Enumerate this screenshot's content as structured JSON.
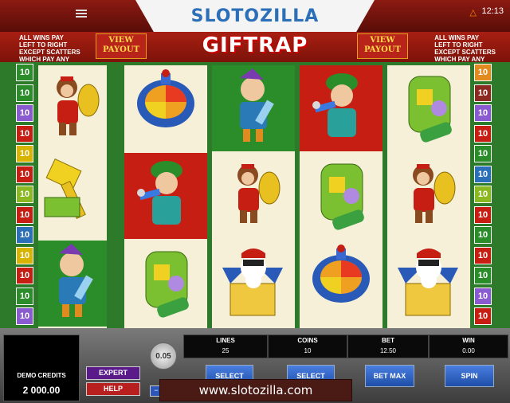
{
  "header": {
    "logo": "SLOTOZILLA",
    "clock": "12:13",
    "flame_icon": "flame-icon"
  },
  "banner": {
    "title": "GIFTRAP",
    "rules_left": [
      "ALL WINS PAY",
      "LEFT TO RIGHT",
      "EXCEPT SCATTERS",
      "WHICH PAY ANY"
    ],
    "rules_right": [
      "ALL WINS PAY",
      "LEFT TO RIGHT",
      "EXCEPT SCATTERS",
      "WHICH PAY ANY"
    ],
    "view_payout_left": "VIEW\nPAYOUT",
    "view_payout_right": "VIEW\nPAYOUT"
  },
  "paylines_left": [
    {
      "label": "10",
      "color": "#2a8d2a"
    },
    {
      "label": "10",
      "color": "#2a8d2a"
    },
    {
      "label": "10",
      "color": "#8a5ad0"
    },
    {
      "label": "10",
      "color": "#c71e14"
    },
    {
      "label": "10",
      "color": "#d8b400"
    },
    {
      "label": "10",
      "color": "#c71e14"
    },
    {
      "label": "10",
      "color": "#8ab820"
    },
    {
      "label": "10",
      "color": "#c71e14"
    },
    {
      "label": "10",
      "color": "#2a6fb8"
    },
    {
      "label": "10",
      "color": "#d8b400"
    },
    {
      "label": "10",
      "color": "#c71e14"
    },
    {
      "label": "10",
      "color": "#2a8d2a"
    },
    {
      "label": "10",
      "color": "#8a5ad0"
    }
  ],
  "paylines_right": [
    {
      "label": "10",
      "color": "#e08a20"
    },
    {
      "label": "10",
      "color": "#8a2a20"
    },
    {
      "label": "10",
      "color": "#8a5ad0"
    },
    {
      "label": "10",
      "color": "#c71e14"
    },
    {
      "label": "10",
      "color": "#2a8d2a"
    },
    {
      "label": "10",
      "color": "#2a6fb8"
    },
    {
      "label": "10",
      "color": "#8ab820"
    },
    {
      "label": "10",
      "color": "#c71e14"
    },
    {
      "label": "10",
      "color": "#2a8d2a"
    },
    {
      "label": "10",
      "color": "#c71e14"
    },
    {
      "label": "10",
      "color": "#2a8d2a"
    },
    {
      "label": "10",
      "color": "#8a5ad0"
    },
    {
      "label": "10",
      "color": "#c71e14"
    }
  ],
  "reels": [
    [
      {
        "symbol": "monkey-cymbals-icon",
        "bg": "plain"
      },
      {
        "symbol": "toy-hammer-icon",
        "bg": "plain"
      },
      {
        "symbol": "elf-icon",
        "bg": "green"
      }
    ],
    [
      {
        "symbol": "spinning-top-icon",
        "bg": "plain"
      },
      {
        "symbol": "singer-elf-icon",
        "bg": "red"
      },
      {
        "symbol": "toy-phone-icon",
        "bg": "plain"
      }
    ],
    [
      {
        "symbol": "elf-icon",
        "bg": "green"
      },
      {
        "symbol": "monkey-cymbals-icon",
        "bg": "plain"
      },
      {
        "symbol": "jack-in-box-icon",
        "bg": "plain"
      }
    ],
    [
      {
        "symbol": "singer-elf-icon",
        "bg": "red"
      },
      {
        "symbol": "toy-phone-icon",
        "bg": "plain"
      },
      {
        "symbol": "spinning-top-icon",
        "bg": "plain"
      }
    ],
    [
      {
        "symbol": "toy-phone-icon",
        "bg": "plain"
      },
      {
        "symbol": "monkey-cymbals-icon",
        "bg": "plain"
      },
      {
        "symbol": "jack-in-box-icon",
        "bg": "plain"
      }
    ]
  ],
  "controls": {
    "credits_label": "DEMO CREDITS",
    "credits_value": "2 000.00",
    "expert": "EXPERT",
    "help": "HELP",
    "coin_value": "0.05",
    "lines_label": "LINES",
    "lines_value": "25",
    "coins_label": "COINS",
    "coins_value": "10",
    "bet_label": "BET",
    "bet_value": "12.50",
    "win_label": "WIN",
    "win_value": "0.00",
    "select_lines": "SELECT",
    "select_coins": "SELECT",
    "bet_max": "BET MAX",
    "spin": "SPIN"
  },
  "footer": {
    "url": "www.slotozilla.com"
  }
}
